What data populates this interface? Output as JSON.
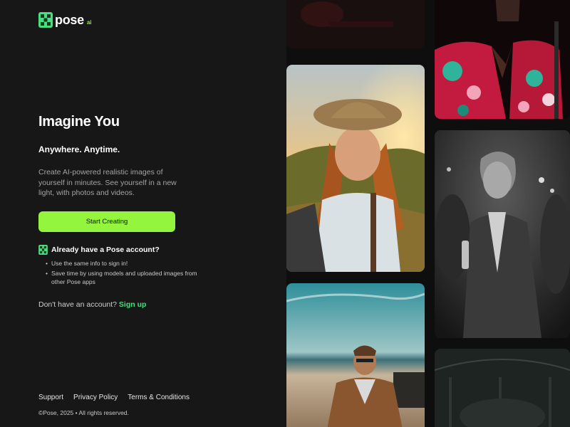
{
  "brand": {
    "name": "pose",
    "suffix": "ai",
    "accent": "#93f53e",
    "logo_icon": "pose-logo-icon"
  },
  "hero": {
    "title": "Imagine You",
    "subtitle": "Anywhere. Anytime.",
    "description": "Create AI-powered realistic images of yourself in minutes. See yourself in a new light, with photos and videos."
  },
  "cta": {
    "label": "Start Creating"
  },
  "account": {
    "title": "Already have a Pose account?",
    "bullets": [
      "Use the same info to sign in!",
      "Save time by using models and uploaded images from other Pose apps"
    ]
  },
  "signup": {
    "prompt": "Don't have an account?",
    "link": "Sign up",
    "link_color": "#4ade80"
  },
  "footer": {
    "links": [
      "Support",
      "Privacy Policy",
      "Terms & Conditions"
    ],
    "copyright": "©Pose, 2025 • All rights reserved."
  },
  "gallery": [
    {
      "name": "photo-floral-shirt-man"
    },
    {
      "name": "photo-woman-hat-sunset"
    },
    {
      "name": "photo-man-bw-party"
    },
    {
      "name": "photo-man-beach"
    },
    {
      "name": "photo-dark-top"
    },
    {
      "name": "photo-dark-bottom"
    }
  ]
}
